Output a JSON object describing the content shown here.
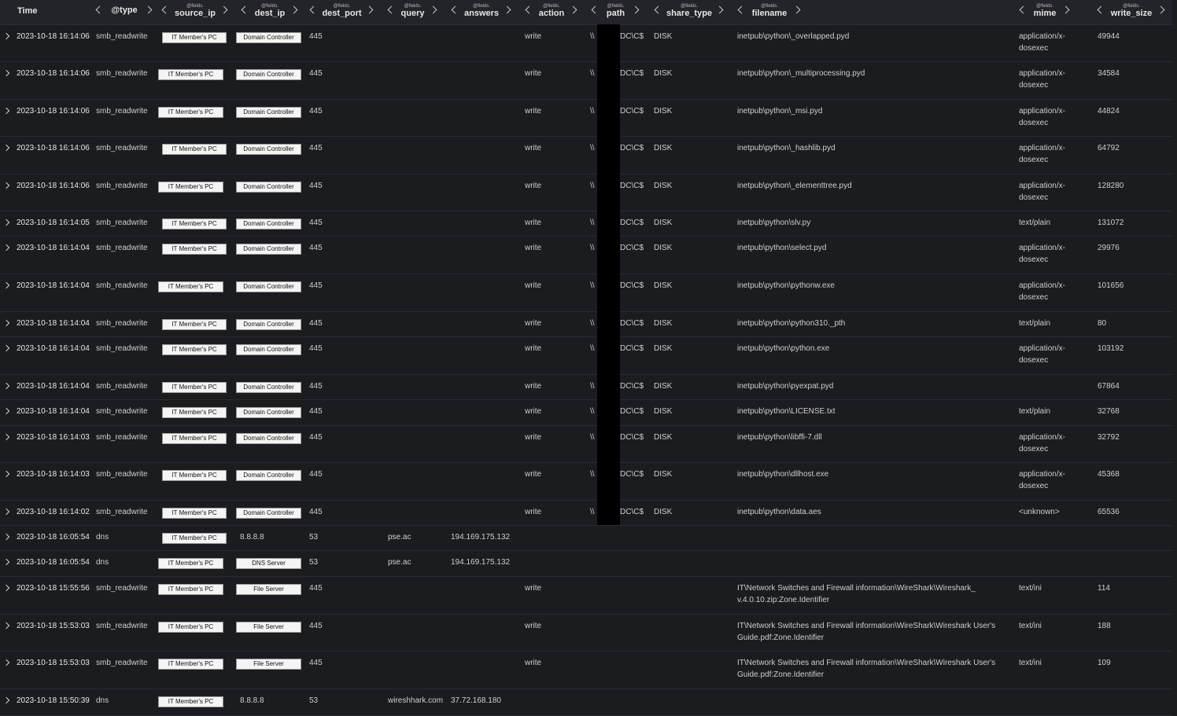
{
  "header": {
    "time": "Time",
    "columns": [
      {
        "prefix": "",
        "label": "@type"
      },
      {
        "prefix": "@fields.",
        "label": "source_ip"
      },
      {
        "prefix": "@fields.",
        "label": "dest_ip"
      },
      {
        "prefix": "@fields.",
        "label": "dest_port"
      },
      {
        "prefix": "@fields.",
        "label": "query"
      },
      {
        "prefix": "@fields.",
        "label": "answers"
      },
      {
        "prefix": "@fields.",
        "label": "action"
      },
      {
        "prefix": "@fields.",
        "label": "path"
      },
      {
        "prefix": "@fields.",
        "label": "share_type"
      },
      {
        "prefix": "@fields.",
        "label": "filename"
      },
      {
        "prefix": "@fields.",
        "label": "mime"
      },
      {
        "prefix": "@fields.",
        "label": "write_size"
      }
    ]
  },
  "rows": [
    {
      "time": "2023-10-18 16:14:06",
      "type": "smb_readwrite",
      "source_ip": "IT Member's PC",
      "dest_ip": "Domain Controller",
      "dest_port": "445",
      "query": "",
      "answers": "",
      "action": "write",
      "path": "\\\\",
      "path2": "DC\\C$",
      "share_type": "DISK",
      "filename": "inetpub\\python\\_overlapped.pyd",
      "mime": "application/x-dosexec",
      "write_size": "49944"
    },
    {
      "time": "2023-10-18 16:14:06",
      "type": "smb_readwrite",
      "source_ip": "IT Member's PC",
      "dest_ip": "Domain Controller",
      "dest_port": "445",
      "query": "",
      "answers": "",
      "action": "write",
      "path": "\\\\",
      "path2": "DC\\C$",
      "share_type": "DISK",
      "filename": "inetpub\\python\\_multiprocessing.pyd",
      "mime": "application/x-dosexec",
      "write_size": "34584"
    },
    {
      "time": "2023-10-18 16:14:06",
      "type": "smb_readwrite",
      "source_ip": "IT Member's PC",
      "dest_ip": "Domain Controller",
      "dest_port": "445",
      "query": "",
      "answers": "",
      "action": "write",
      "path": "\\\\",
      "path2": "DC\\C$",
      "share_type": "DISK",
      "filename": "inetpub\\python\\_msi.pyd",
      "mime": "application/x-dosexec",
      "write_size": "44824"
    },
    {
      "time": "2023-10-18 16:14:06",
      "type": "smb_readwrite",
      "source_ip": "IT Member's PC",
      "dest_ip": "Domain Controller",
      "dest_port": "445",
      "query": "",
      "answers": "",
      "action": "write",
      "path": "\\\\",
      "path2": "DC\\C$",
      "share_type": "DISK",
      "filename": "inetpub\\python\\_hashlib.pyd",
      "mime": "application/x-dosexec",
      "write_size": "64792"
    },
    {
      "time": "2023-10-18 16:14:06",
      "type": "smb_readwrite",
      "source_ip": "IT Member's PC",
      "dest_ip": "Domain Controller",
      "dest_port": "445",
      "query": "",
      "answers": "",
      "action": "write",
      "path": "\\\\",
      "path2": "DC\\C$",
      "share_type": "DISK",
      "filename": "inetpub\\python\\_elementtree.pyd",
      "mime": "application/x-dosexec",
      "write_size": "128280"
    },
    {
      "time": "2023-10-18 16:14:05",
      "type": "smb_readwrite",
      "source_ip": "IT Member's PC",
      "dest_ip": "Domain Controller",
      "dest_port": "445",
      "query": "",
      "answers": "",
      "action": "write",
      "path": "\\\\",
      "path2": "DC\\C$",
      "share_type": "DISK",
      "filename": "inetpub\\python\\slv.py",
      "mime": "text/plain",
      "write_size": "131072"
    },
    {
      "time": "2023-10-18 16:14:04",
      "type": "smb_readwrite",
      "source_ip": "IT Member's PC",
      "dest_ip": "Domain Controller",
      "dest_port": "445",
      "query": "",
      "answers": "",
      "action": "write",
      "path": "\\\\",
      "path2": "DC\\C$",
      "share_type": "DISK",
      "filename": "inetpub\\python\\select.pyd",
      "mime": "application/x-dosexec",
      "write_size": "29976"
    },
    {
      "time": "2023-10-18 16:14:04",
      "type": "smb_readwrite",
      "source_ip": "IT Member's PC",
      "dest_ip": "Domain Controller",
      "dest_port": "445",
      "query": "",
      "answers": "",
      "action": "write",
      "path": "\\\\",
      "path2": "DC\\C$",
      "share_type": "DISK",
      "filename": "inetpub\\python\\pythonw.exe",
      "mime": "application/x-dosexec",
      "write_size": "101656"
    },
    {
      "time": "2023-10-18 16:14:04",
      "type": "smb_readwrite",
      "source_ip": "IT Member's PC",
      "dest_ip": "Domain Controller",
      "dest_port": "445",
      "query": "",
      "answers": "",
      "action": "write",
      "path": "\\\\",
      "path2": "DC\\C$",
      "share_type": "DISK",
      "filename": "inetpub\\python\\python310._pth",
      "mime": "text/plain",
      "write_size": "80"
    },
    {
      "time": "2023-10-18 16:14:04",
      "type": "smb_readwrite",
      "source_ip": "IT Member's PC",
      "dest_ip": "Domain Controller",
      "dest_port": "445",
      "query": "",
      "answers": "",
      "action": "write",
      "path": "\\\\",
      "path2": "DC\\C$",
      "share_type": "DISK",
      "filename": "inetpub\\python\\python.exe",
      "mime": "application/x-dosexec",
      "write_size": "103192"
    },
    {
      "time": "2023-10-18 16:14:04",
      "type": "smb_readwrite",
      "source_ip": "IT Member's PC",
      "dest_ip": "Domain Controller",
      "dest_port": "445",
      "query": "",
      "answers": "",
      "action": "write",
      "path": "\\\\",
      "path2": "DC\\C$",
      "share_type": "DISK",
      "filename": "inetpub\\python\\pyexpat.pyd",
      "mime": "",
      "write_size": "67864"
    },
    {
      "time": "2023-10-18 16:14:04",
      "type": "smb_readwrite",
      "source_ip": "IT Member's PC",
      "dest_ip": "Domain Controller",
      "dest_port": "445",
      "query": "",
      "answers": "",
      "action": "write",
      "path": "\\\\",
      "path2": "DC\\C$",
      "share_type": "DISK",
      "filename": "inetpub\\python\\LICENSE.txt",
      "mime": "text/plain",
      "write_size": "32768"
    },
    {
      "time": "2023-10-18 16:14:03",
      "type": "smb_readwrite",
      "source_ip": "IT Member's PC",
      "dest_ip": "Domain Controller",
      "dest_port": "445",
      "query": "",
      "answers": "",
      "action": "write",
      "path": "\\\\",
      "path2": "DC\\C$",
      "share_type": "DISK",
      "filename": "inetpub\\python\\libffi-7.dll",
      "mime": "application/x-dosexec",
      "write_size": "32792"
    },
    {
      "time": "2023-10-18 16:14:03",
      "type": "smb_readwrite",
      "source_ip": "IT Member's PC",
      "dest_ip": "Domain Controller",
      "dest_port": "445",
      "query": "",
      "answers": "",
      "action": "write",
      "path": "\\\\",
      "path2": "DC\\C$",
      "share_type": "DISK",
      "filename": "inetpub\\python\\dllhost.exe",
      "mime": "application/x-dosexec",
      "write_size": "45368"
    },
    {
      "time": "2023-10-18 16:14:02",
      "type": "smb_readwrite",
      "source_ip": "IT Member's PC",
      "dest_ip": "Domain Controller",
      "dest_port": "445",
      "query": "",
      "answers": "",
      "action": "write",
      "path": "\\\\",
      "path2": "DC\\C$",
      "share_type": "DISK",
      "filename": "inetpub\\python\\data.aes",
      "mime": "<unknown>",
      "write_size": "65536"
    },
    {
      "time": "2023-10-18 16:05:54",
      "type": "dns",
      "source_ip": "IT Member's PC",
      "dest_ip": "8.8.8.8",
      "dest_port": "53",
      "query": "pse.ac",
      "answers": "194.169.175.132",
      "action": "",
      "path": "",
      "path2": "",
      "share_type": "",
      "filename": "",
      "mime": "",
      "write_size": ""
    },
    {
      "time": "2023-10-18 16:05:54",
      "type": "dns",
      "source_ip": "IT Member's PC",
      "dest_ip": "DNS Server",
      "dest_port": "53",
      "query": "pse.ac",
      "answers": "194.169.175.132",
      "action": "",
      "path": "",
      "path2": "",
      "share_type": "",
      "filename": "",
      "mime": "",
      "write_size": ""
    },
    {
      "time": "2023-10-18 15:55:56",
      "type": "smb_readwrite",
      "source_ip": "IT Member's PC",
      "dest_ip": "File Server",
      "dest_port": "445",
      "query": "",
      "answers": "",
      "action": "write",
      "path": "",
      "path2": "",
      "share_type": "",
      "filename": "IT\\Network Switches and Firewall information\\WireShark\\Wireshark_ v.4.0.10.zip:Zone.Identifier",
      "mime": "text/ini",
      "write_size": "114"
    },
    {
      "time": "2023-10-18 15:53:03",
      "type": "smb_readwrite",
      "source_ip": "IT Member's PC",
      "dest_ip": "File Server",
      "dest_port": "445",
      "query": "",
      "answers": "",
      "action": "write",
      "path": "",
      "path2": "",
      "share_type": "",
      "filename": "IT\\Network Switches and Firewall information\\WireShark\\Wireshark User's Guide.pdf:Zone.Identifier",
      "mime": "text/ini",
      "write_size": "188"
    },
    {
      "time": "2023-10-18 15:53:03",
      "type": "smb_readwrite",
      "source_ip": "IT Member's PC",
      "dest_ip": "File Server",
      "dest_port": "445",
      "query": "",
      "answers": "",
      "action": "write",
      "path": "",
      "path2": "",
      "share_type": "",
      "filename": "IT\\Network Switches and Firewall information\\WireShark\\Wireshark User's Guide.pdf:Zone.Identifier",
      "mime": "text/ini",
      "write_size": "109"
    },
    {
      "time": "2023-10-18 15:50:39",
      "type": "dns",
      "source_ip": "IT Member's PC",
      "dest_ip": "8.8.8.8",
      "dest_port": "53",
      "query": "wireshhark.com",
      "answers": "37.72.168.180",
      "action": "",
      "path": "",
      "path2": "",
      "share_type": "",
      "filename": "",
      "mime": "",
      "write_size": ""
    }
  ]
}
